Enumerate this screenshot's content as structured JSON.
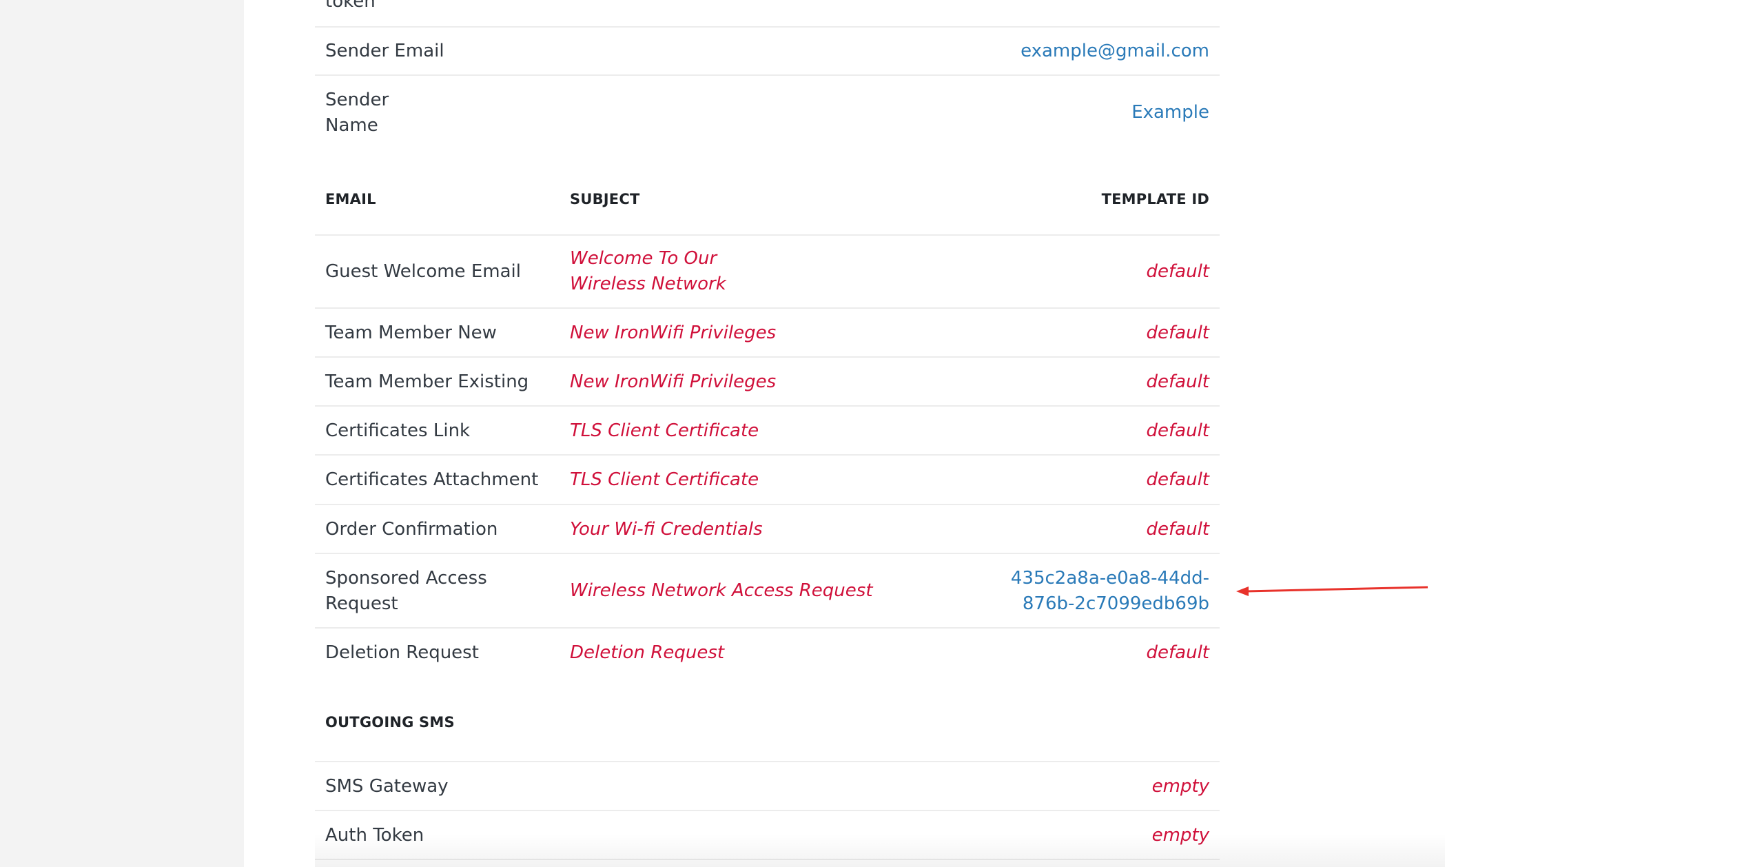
{
  "top_partial_label": "token",
  "settings": [
    {
      "label": "Sender Email",
      "value": "example@gmail.com"
    },
    {
      "label": "Sender Name",
      "value": "Example"
    }
  ],
  "email_table": {
    "headers": {
      "email": "EMAIL",
      "subject": "SUBJECT",
      "template_id": "TEMPLATE ID"
    },
    "rows": [
      {
        "email": "Guest Welcome Email",
        "subject": "Welcome To Our Wireless Network",
        "template_id": "default"
      },
      {
        "email": "Team Member New",
        "subject": "New IronWifi Privileges",
        "template_id": "default"
      },
      {
        "email": "Team Member Existing",
        "subject": "New IronWifi Privileges",
        "template_id": "default"
      },
      {
        "email": "Certificates Link",
        "subject": "TLS Client Certificate",
        "template_id": "default"
      },
      {
        "email": "Certificates Attachment",
        "subject": "TLS Client Certificate",
        "template_id": "default"
      },
      {
        "email": "Order Confirmation",
        "subject": "Your Wi-fi Credentials",
        "template_id": "default"
      },
      {
        "email": "Sponsored Access Request",
        "subject": "Wireless Network Access Request",
        "template_id": "435c2a8a-e0a8-44dd-876b-2c7099edb69b"
      },
      {
        "email": "Deletion Request",
        "subject": "Deletion Request",
        "template_id": "default"
      }
    ]
  },
  "sms": {
    "heading": "OUTGOING SMS",
    "rows": [
      {
        "label": "SMS Gateway",
        "value": "empty"
      },
      {
        "label": "Auth Token",
        "value": "empty"
      }
    ]
  },
  "colors": {
    "accent_blue": "#2a7ab8",
    "accent_red": "#d0103a",
    "arrow_red": "#e8322b"
  }
}
